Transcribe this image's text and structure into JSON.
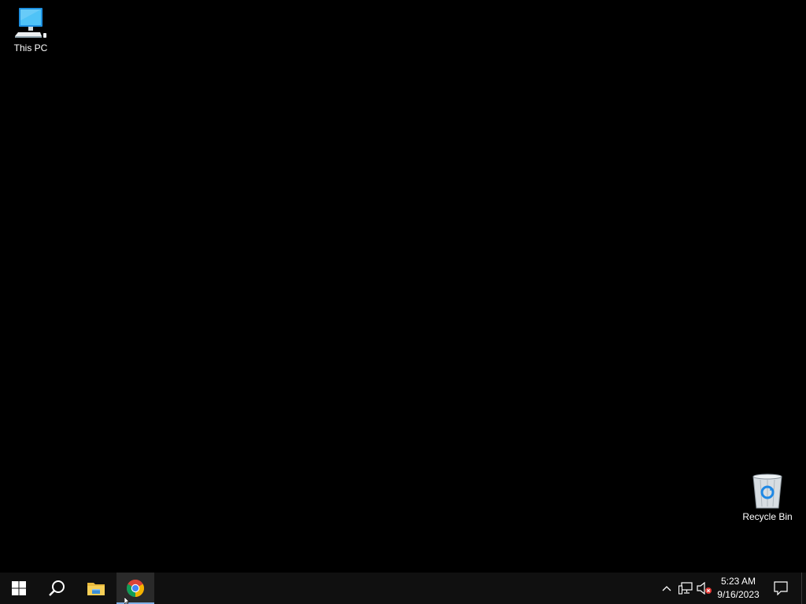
{
  "desktop": {
    "icons": [
      {
        "label": "This PC",
        "icon": "computer-icon"
      },
      {
        "label": "Recycle Bin",
        "icon": "recycle-bin-icon"
      }
    ],
    "background_color": "#000000"
  },
  "taskbar": {
    "background_color": "#101010",
    "buttons": [
      {
        "name": "start",
        "icon": "windows-logo-icon"
      },
      {
        "name": "search",
        "icon": "search-icon"
      },
      {
        "name": "file-explorer",
        "icon": "folder-icon"
      },
      {
        "name": "google-chrome",
        "icon": "chrome-icon",
        "active": true
      }
    ],
    "tray": {
      "icons": [
        "chevron-up-icon",
        "network-icon",
        "volume-muted-icon"
      ],
      "time": "5:23 AM",
      "date": "9/16/2023",
      "action_center_icon": "notification-icon"
    }
  }
}
